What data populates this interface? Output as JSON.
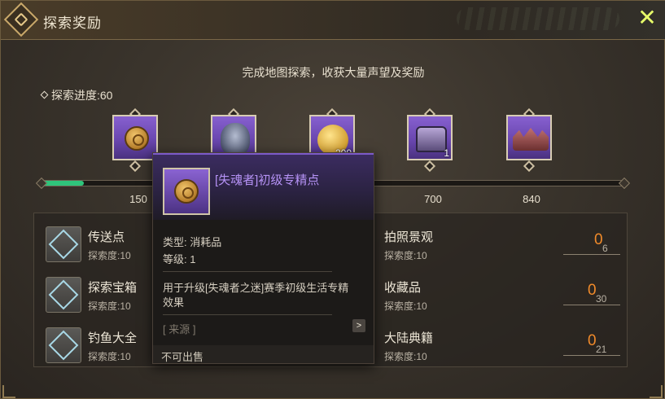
{
  "window": {
    "title": "探索奖励",
    "close_icon": "close-icon",
    "accent_color": "#e8ff6a"
  },
  "subtitle": "完成地图探索，收获大量声望及奖励",
  "progress": {
    "label": "探索进度:60",
    "value": 60,
    "max": 840,
    "fill_color": "#2fc47b"
  },
  "milestones": [
    {
      "threshold": "150",
      "icon": "coin-icon",
      "quantity": ""
    },
    {
      "threshold": "",
      "icon": "bird-icon",
      "quantity": ""
    },
    {
      "threshold": "",
      "icon": "gold-coin-icon",
      "quantity": "200"
    },
    {
      "threshold": "700",
      "icon": "chest-icon",
      "quantity": "1"
    },
    {
      "threshold": "840",
      "icon": "crown-icon",
      "quantity": ""
    }
  ],
  "tasks": [
    {
      "name": "传送点",
      "sub": "探索度:10",
      "count": "",
      "total": ""
    },
    {
      "name": "探索宝箱",
      "sub": "探索度:10",
      "count": "",
      "total": ""
    },
    {
      "name": "钓鱼大全",
      "sub": "探索度:10",
      "count": "",
      "total": ""
    },
    {
      "name": "拍照景观",
      "sub": "探索度:10",
      "count": "0",
      "total": "6"
    },
    {
      "name": "收藏品",
      "sub": "探索度:10",
      "count": "0",
      "total": "30"
    },
    {
      "name": "大陆典籍",
      "sub": "探索度:10",
      "count": "0",
      "total": "21"
    }
  ],
  "tooltip": {
    "name": "[失魂者]初级专精点",
    "type": "类型: 消耗品",
    "level": "等级: 1",
    "description": "用于升级[失魂者之迷]赛季初级生活专精效果",
    "source": "[ 来源 ]",
    "source_arrow": ">",
    "footer": "不可出售",
    "name_color": "#b592f5"
  }
}
